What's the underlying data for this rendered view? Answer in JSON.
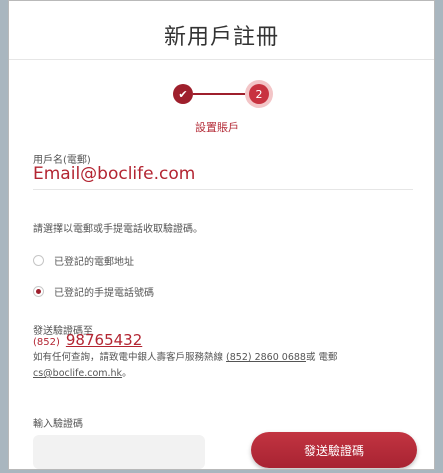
{
  "header": {
    "title": "新用戶註冊"
  },
  "stepper": {
    "step1_icon": "✔",
    "step2_number": "2",
    "current_label": "設置賬戶"
  },
  "username": {
    "label": "用戶名(電郵)",
    "value": "Email@boclife.com"
  },
  "verification": {
    "instruction": "請選擇以電郵或手提電話收取驗證碼。",
    "option_email": "已登記的電郵地址",
    "option_phone": "已登記的手提電話號碼",
    "selected": "phone"
  },
  "send_to": {
    "label": "發送驗證碼至",
    "prefix": "(852)",
    "number": "98765432"
  },
  "contact": {
    "text1": "如有任何查詢，請致電中銀人壽客戶服務熱線 ",
    "hotline": "(852) 2860 0688",
    "text2": "或 電郵",
    "email": "cs@boclife.com.hk",
    "text3": "。"
  },
  "code": {
    "label": "輸入驗證碼",
    "placeholder": ""
  },
  "send_button": {
    "label": "發送驗證碼"
  },
  "colors": {
    "accent": "#9e1f2c",
    "button": "#b02a37"
  }
}
